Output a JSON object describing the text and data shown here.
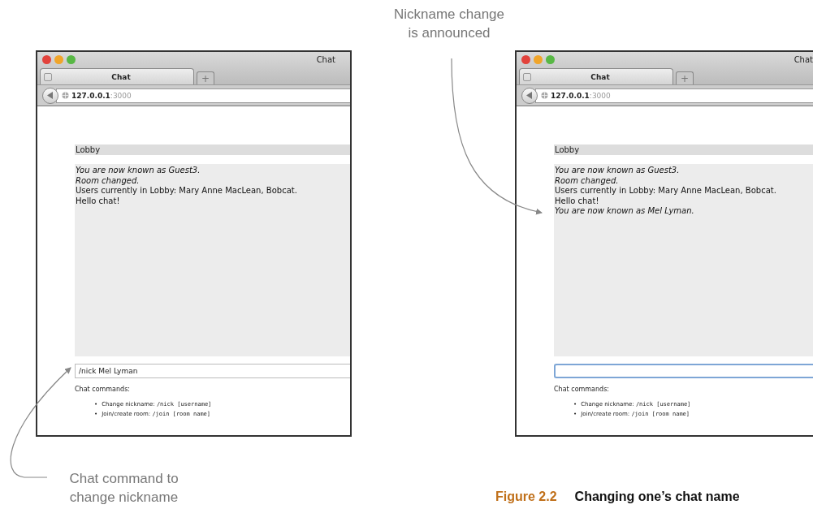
{
  "annotations": [
    {
      "text": "Nickname change is announced"
    },
    {
      "text": "Chat command to change nickname"
    }
  ],
  "windows": [
    {
      "window_title": "Chat",
      "tab": {
        "label": "Chat",
        "selected": true
      },
      "new_tab": "+",
      "address": {
        "host": "127.0.0.1",
        "port": ":3000"
      },
      "room": "Lobby",
      "messages": [
        {
          "kind": "notice",
          "text": "You are now known as Guest3."
        },
        {
          "kind": "notice",
          "text": "Room changed."
        },
        {
          "kind": "message",
          "text": "Users currently in Lobby: Mary Anne MacLean, Bobcat."
        },
        {
          "kind": "message",
          "text": "Hello chat!"
        }
      ],
      "input": {
        "value": "/nick Mel Lyman",
        "focused": false
      },
      "commands_label": "Chat commands:",
      "commands": [
        {
          "bullet": "•",
          "label": "Change nickname:",
          "syntax": "/nick [username]"
        },
        {
          "bullet": "•",
          "label": "Join/create room:",
          "syntax": "/join [room name]"
        }
      ]
    },
    {
      "window_title": "Chat",
      "tab": {
        "label": "Chat",
        "selected": true
      },
      "new_tab": "+",
      "address": {
        "host": "127.0.0.1",
        "port": ":3000"
      },
      "room": "Lobby",
      "messages": [
        {
          "kind": "notice",
          "text": "You are now known as Guest3."
        },
        {
          "kind": "notice",
          "text": "Room changed."
        },
        {
          "kind": "message",
          "text": "Users currently in Lobby: Mary Anne MacLean, Bobcat."
        },
        {
          "kind": "message",
          "text": "Hello chat!"
        },
        {
          "kind": "notice",
          "text": "You are now known as Mel Lyman."
        }
      ],
      "input": {
        "focused": true
      },
      "commands_label": "Chat commands:",
      "commands": [
        {
          "bullet": "•",
          "label": "Change nickname:",
          "syntax": "/nick [username]"
        },
        {
          "bullet": "•",
          "label": "Join/create room:",
          "syntax": "/join [room name]"
        }
      ]
    }
  ],
  "caption": {
    "number": "Figure 2.2",
    "title": "Changing one’s chat name"
  }
}
